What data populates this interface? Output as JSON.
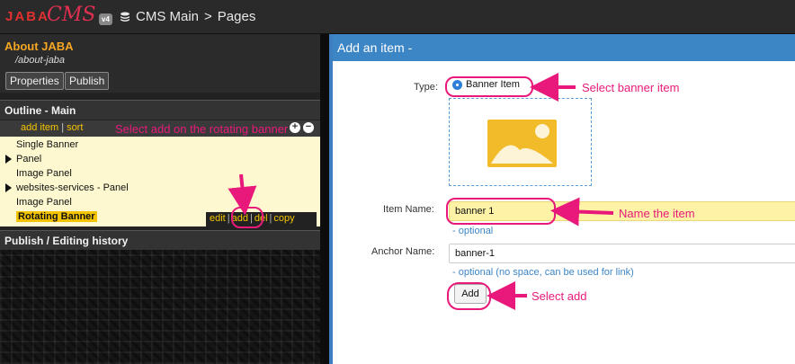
{
  "topbar": {
    "logo_text": "JABA",
    "logo_cms": "CMS",
    "logo_version": "v4",
    "breadcrumb_root": "CMS Main",
    "breadcrumb_sep": ">",
    "breadcrumb_current": "Pages",
    "icon": "stack-icon"
  },
  "page": {
    "title": "About JABA",
    "path": "/about-jaba",
    "properties_label": "Properties",
    "publish_label": "Publish"
  },
  "outline": {
    "title": "Outline - Main",
    "add_item_label": "add item",
    "sort_label": "sort",
    "separator": "|",
    "plus_label": "+",
    "minus_label": "−",
    "items": [
      {
        "label": "Single Banner",
        "expandable": false
      },
      {
        "label": "Panel",
        "expandable": true
      },
      {
        "label": "Image Panel",
        "expandable": false
      },
      {
        "label": "websites-services - Panel",
        "expandable": true
      },
      {
        "label": "Image Panel",
        "expandable": false
      },
      {
        "label": "Rotating Banner",
        "expandable": false,
        "selected": true
      }
    ],
    "row_actions": {
      "edit": "edit",
      "add": "add",
      "del": "del",
      "copy": "copy"
    }
  },
  "history": {
    "title": "Publish / Editing history"
  },
  "form": {
    "title": "Add an item -",
    "type_label": "Type:",
    "type_value": "Banner Item",
    "image_icon": "image-placeholder-icon",
    "item_name_label": "Item Name:",
    "item_name_value": "banner 1",
    "item_name_hint": "- optional",
    "anchor_label": "Anchor Name:",
    "anchor_value": "banner-1",
    "anchor_hint": "- optional (no space, can be used for link)",
    "add_button": "Add"
  },
  "annotations": {
    "left_note": "Select add on the rotating banner",
    "type_note": "Select banner item",
    "name_note": "Name the item",
    "add_note": "Select add",
    "color": "#e8197a"
  },
  "colors": {
    "accent_blue": "#3d86c6",
    "highlight_yellow": "#f5c400",
    "title_orange": "#f5a623",
    "outline_bg": "#fdf8cf"
  }
}
